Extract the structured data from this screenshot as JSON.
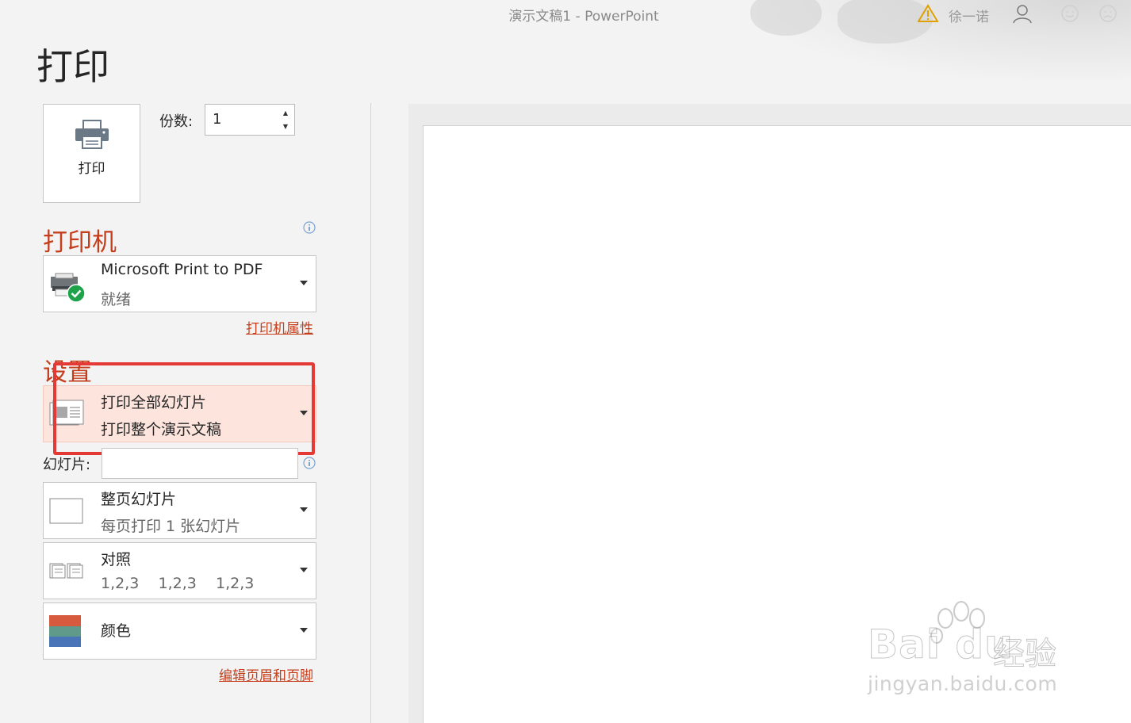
{
  "window": {
    "title": "演示文稿1  -  PowerPoint",
    "user_name": "徐一诺"
  },
  "page": {
    "title": "打印"
  },
  "print_button": {
    "label": "打印"
  },
  "copies": {
    "label": "份数:",
    "value": "1"
  },
  "printer_section": {
    "heading": "打印机",
    "selected_printer": "Microsoft Print to PDF",
    "status": "就绪",
    "properties_link": "打印机属性"
  },
  "settings_section": {
    "heading": "设置",
    "print_range": {
      "main": "打印全部幻灯片",
      "sub": "打印整个演示文稿"
    },
    "slides_label": "幻灯片:",
    "slides_value": "",
    "layout": {
      "main": "整页幻灯片",
      "sub": "每页打印 1 张幻灯片"
    },
    "collation": {
      "main": "对照",
      "sub": "1,2,3    1,2,3    1,2,3"
    },
    "color": {
      "main": "颜色"
    },
    "header_footer_link": "编辑页眉和页脚"
  },
  "watermark": {
    "brand": "Bai du",
    "product": "经验",
    "url": "jingyan.baidu.com"
  },
  "colors": {
    "accent": "#c43e1c",
    "highlight": "#fde4dd",
    "annotation": "#e53935"
  }
}
